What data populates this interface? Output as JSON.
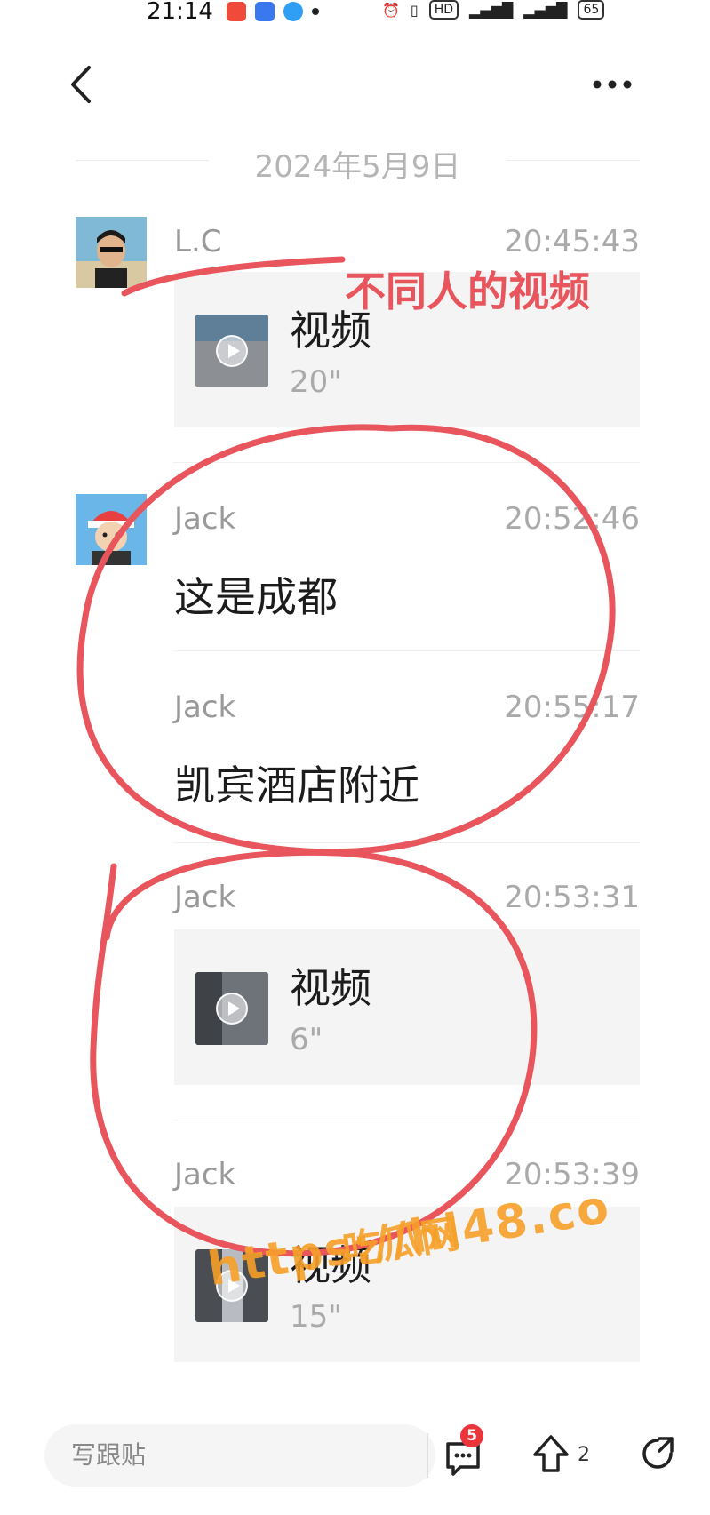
{
  "status_bar": {
    "time": "21:14",
    "network": "HD",
    "battery": "65"
  },
  "nav": {
    "back_icon": "chevron-left-icon",
    "more_icon": "more-dots-icon"
  },
  "date_divider": "2024年5月9日",
  "messages": [
    {
      "sender": "L.C",
      "time": "20:45:43",
      "type": "video",
      "video_label": "视频",
      "duration": "20\""
    },
    {
      "sender": "Jack",
      "time": "20:52:46",
      "type": "text",
      "text": "这是成都"
    },
    {
      "sender": "Jack",
      "time": "20:55:17",
      "type": "text",
      "text": "凯宾酒店附近"
    },
    {
      "sender": "Jack",
      "time": "20:53:31",
      "type": "video",
      "video_label": "视频",
      "duration": "6\""
    },
    {
      "sender": "Jack",
      "time": "20:53:39",
      "type": "video",
      "video_label": "视频",
      "duration": "15\""
    }
  ],
  "annotation": {
    "label": "不同人的视频",
    "color": "#e8555c"
  },
  "watermark": {
    "line1": "吃瓜网",
    "line2": "https://hl48.co"
  },
  "bottom_bar": {
    "reply_placeholder": "写跟贴",
    "comment_badge": "5",
    "share_count": "2"
  }
}
